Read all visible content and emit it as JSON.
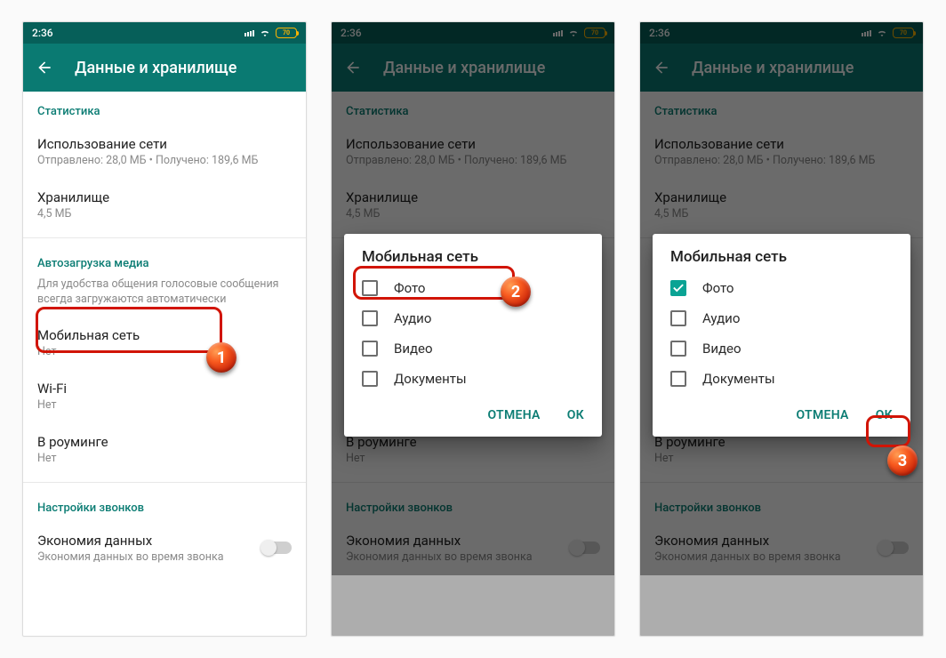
{
  "status": {
    "time": "2:36",
    "battery": "70"
  },
  "toolbar": {
    "title": "Данные и хранилище"
  },
  "sections": {
    "stats_head": "Статистика",
    "network_usage": {
      "label": "Использование сети",
      "sub": "Отправлено: 28,0 МБ • Получено: 189,6 МБ"
    },
    "storage": {
      "label": "Хранилище",
      "sub": "4,5 МБ"
    },
    "autodl_head": "Автозагрузка медиа",
    "autodl_desc": "Для удобства общения голосовые сообщения всегда загружаются автоматически",
    "mobile": {
      "label": "Мобильная сеть",
      "sub_none": "Нет"
    },
    "wifi": {
      "label": "Wi-Fi",
      "sub_none": "Нет"
    },
    "roaming": {
      "label": "В роуминге",
      "sub_none": "Нет"
    },
    "calls_head": "Настройки звонков",
    "data_saver": {
      "label": "Экономия данных",
      "sub": "Экономия данных во время звонка"
    }
  },
  "dialog": {
    "title": "Мобильная сеть",
    "options": {
      "photo": "Фото",
      "audio": "Аудио",
      "video": "Видео",
      "docs": "Документы"
    },
    "cancel": "ОТМЕНА",
    "ok": "ОК"
  },
  "badges": {
    "b1": "1",
    "b2": "2",
    "b3": "3"
  }
}
